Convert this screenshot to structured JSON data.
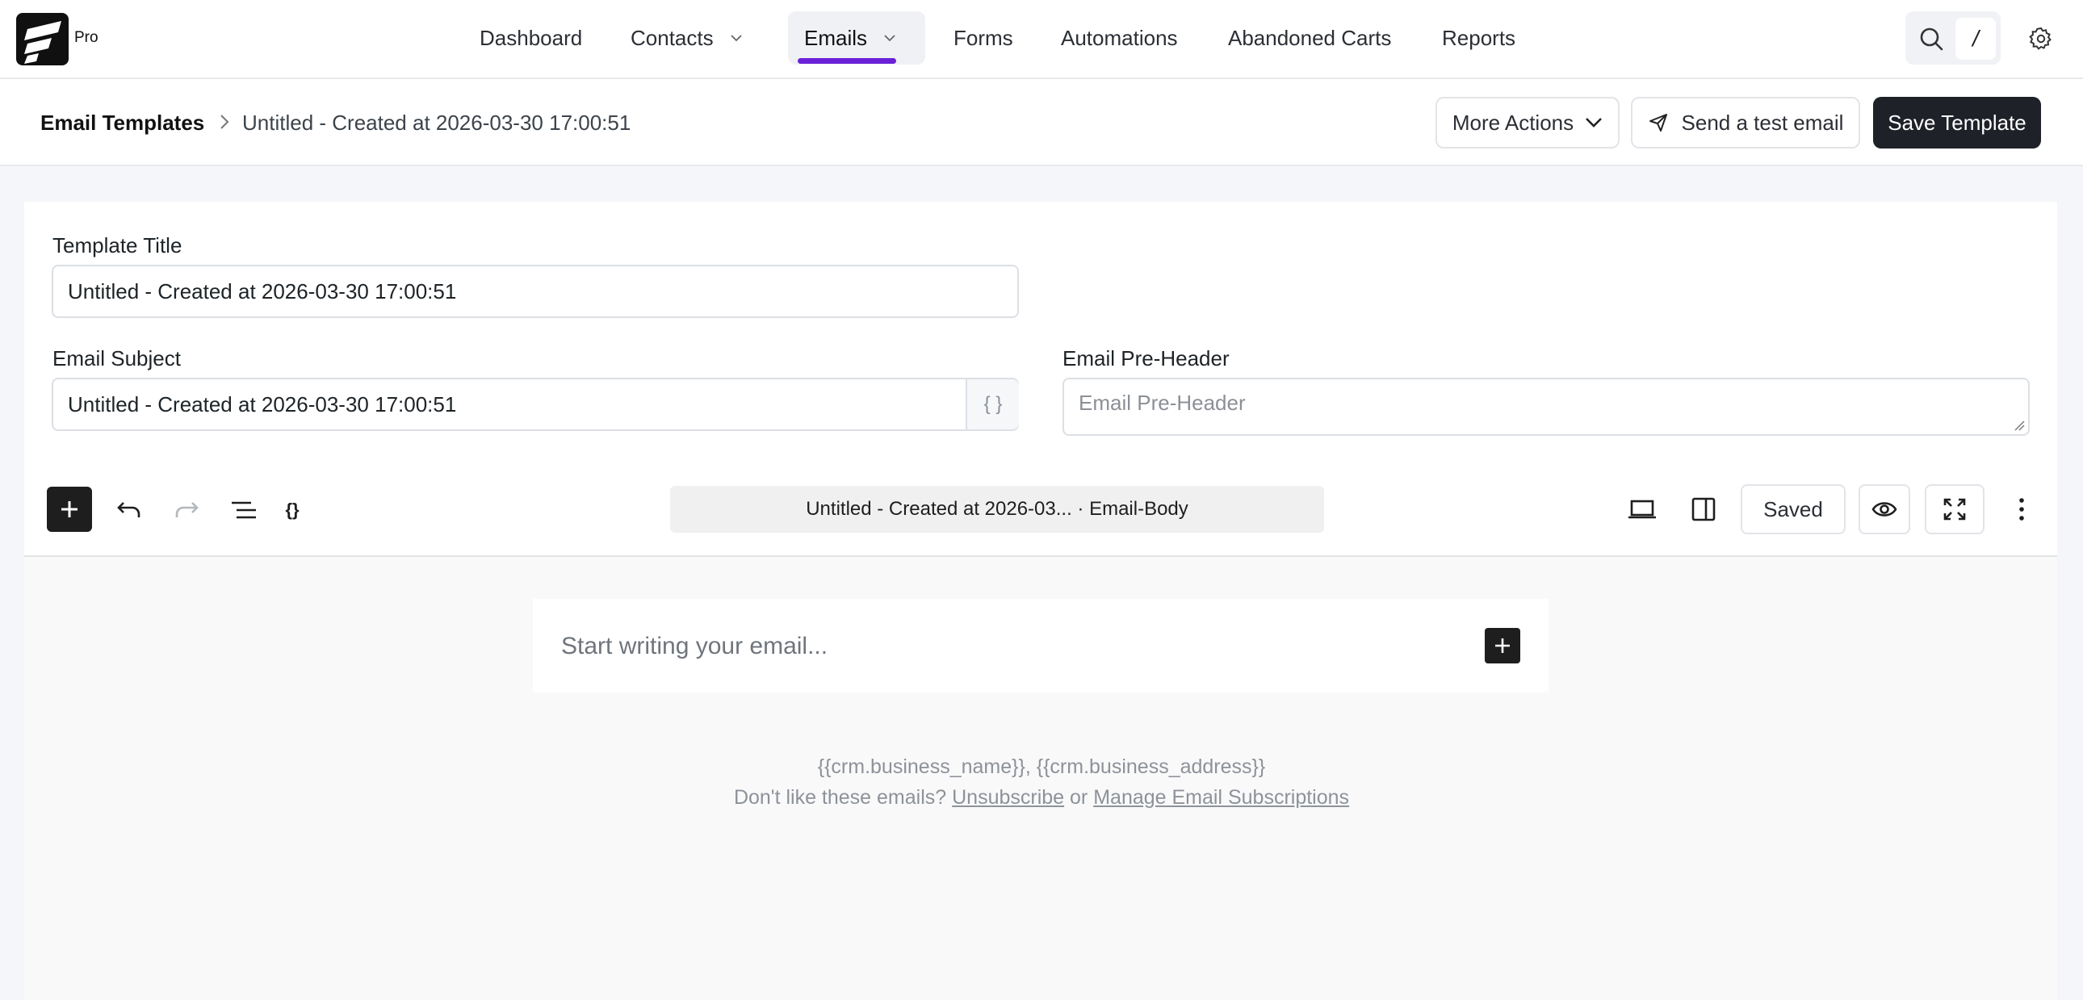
{
  "brand": {
    "badge": "Pro"
  },
  "nav": {
    "items": [
      {
        "label": "Dashboard"
      },
      {
        "label": "Contacts"
      },
      {
        "label": "Emails"
      },
      {
        "label": "Forms"
      },
      {
        "label": "Automations"
      },
      {
        "label": "Abandoned Carts"
      },
      {
        "label": "Reports"
      }
    ],
    "active": "Emails",
    "accent_color": "#6b21d8",
    "shortcut_key": "/"
  },
  "breadcrumb": {
    "root": "Email Templates",
    "current": "Untitled - Created at 2026-03-30 17:00:51"
  },
  "header_actions": {
    "more_actions": "More Actions",
    "send_test": "Send a test email",
    "save": "Save Template"
  },
  "form": {
    "template_title": {
      "label": "Template Title",
      "value": "Untitled - Created at 2026-03-30 17:00:51"
    },
    "email_subject": {
      "label": "Email Subject",
      "value": "Untitled - Created at 2026-03-30 17:00:51",
      "merge_tag_button": "{ }"
    },
    "pre_header": {
      "label": "Email Pre-Header",
      "placeholder": "Email Pre-Header"
    }
  },
  "editor": {
    "document_title": "Untitled - Created at 2026-03... · Email-Body",
    "shortcode_button": "{}",
    "save_state": "Saved",
    "placeholder": "Start writing your email..."
  },
  "email_footer": {
    "line1": "{{crm.business_name}}, {{crm.business_address}}",
    "prefix": "Don't like these emails?",
    "unsubscribe": "Unsubscribe",
    "or": "or",
    "manage": "Manage Email Subscriptions"
  }
}
